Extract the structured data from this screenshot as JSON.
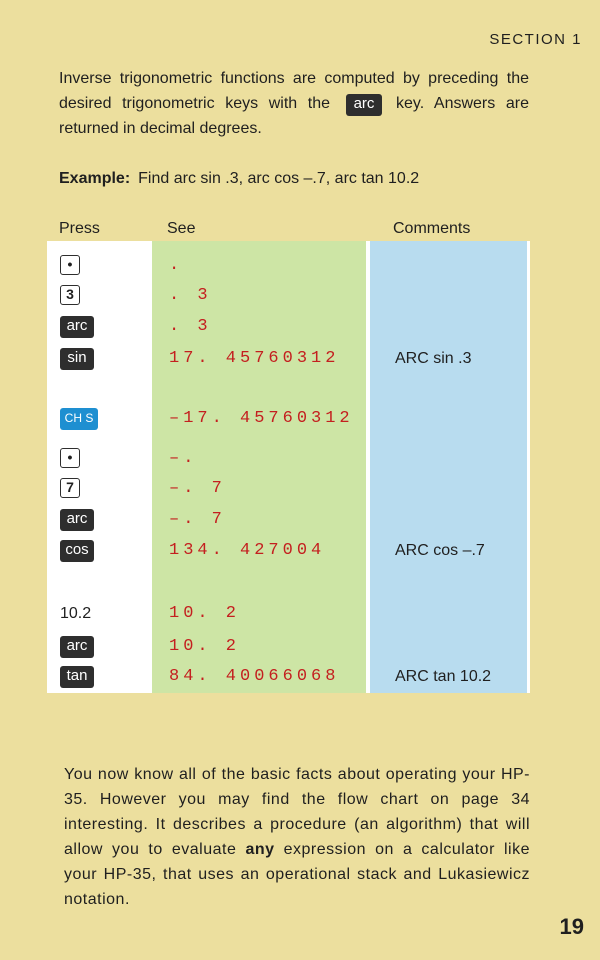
{
  "header": {
    "section": "SECTION 1"
  },
  "intro": {
    "before_key": "Inverse trigonometric functions are computed by preceding the desired trigonometric keys with the",
    "key_label": "arc",
    "after_key": "key. Answers are returned in decimal degrees."
  },
  "example": {
    "label": "Example:",
    "text": "Find arc sin .3, arc cos –.7, arc tan 10.2"
  },
  "table": {
    "headers": {
      "press": "Press",
      "see": "See",
      "comments": "Comments"
    },
    "rows": [
      {
        "press": "•",
        "press_style": "outline",
        "see": ".",
        "comment": ""
      },
      {
        "press": "3",
        "press_style": "outline",
        "see": ". 3",
        "comment": ""
      },
      {
        "press": "arc",
        "press_style": "dark",
        "see": ". 3",
        "comment": ""
      },
      {
        "press": "sin",
        "press_style": "dark",
        "see": "17. 45760312",
        "comment": "ARC sin .3"
      },
      {
        "press": "CH S",
        "press_style": "blue",
        "see": "–17. 45760312",
        "comment": ""
      },
      {
        "press": "•",
        "press_style": "outline",
        "see": "–.",
        "comment": ""
      },
      {
        "press": "7",
        "press_style": "outline",
        "see": "–. 7",
        "comment": ""
      },
      {
        "press": "arc",
        "press_style": "dark",
        "see": "–. 7",
        "comment": ""
      },
      {
        "press": "cos",
        "press_style": "dark",
        "see": "134. 427004",
        "comment": "ARC cos –.7"
      },
      {
        "press": "10.2",
        "press_style": "text",
        "see": "10. 2",
        "comment": ""
      },
      {
        "press": "arc",
        "press_style": "dark",
        "see": "10. 2",
        "comment": ""
      },
      {
        "press": "tan",
        "press_style": "dark",
        "see": "84. 40066068",
        "comment": "ARC tan 10.2"
      }
    ]
  },
  "outro": {
    "before_bold": "You now know all of the basic facts about operating your HP-35. However you may find the flow chart on page 34 interesting. It describes a procedure (an algorithm) that will allow you to evaluate",
    "bold": "any",
    "after_bold": "expression on a calculator like your HP-35, that uses an operational stack and Lukasiewicz notation."
  },
  "footer": {
    "page_number": "19"
  },
  "colors": {
    "page": "#ecdf9e",
    "press_panel": "#ffffff",
    "see_panel": "#cde5a5",
    "comment_panel": "#b8dcef",
    "display_text": "#c41f1f",
    "key_dark": "#2e2e2e",
    "key_blue": "#1e8fd1"
  }
}
